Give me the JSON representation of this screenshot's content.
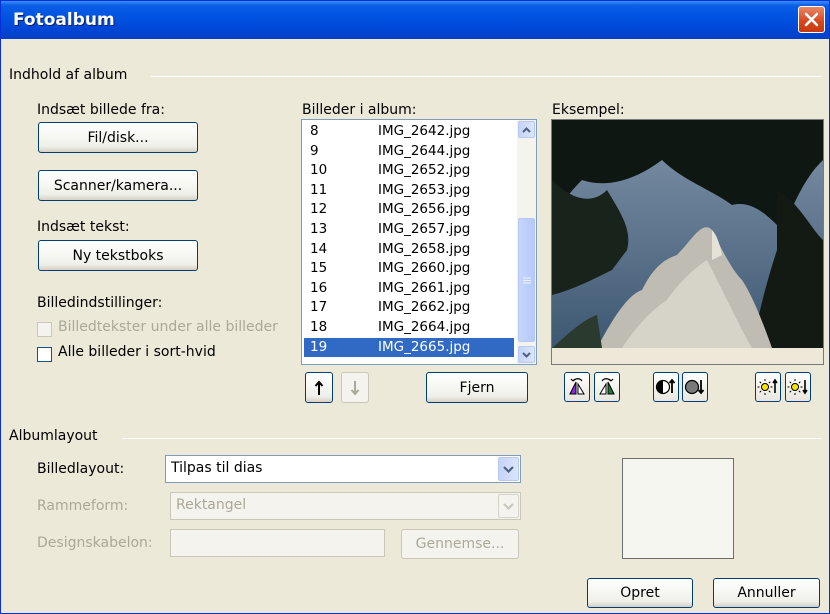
{
  "window": {
    "title": "Fotoalbum"
  },
  "content_group": {
    "title": "Indhold af album",
    "insert_picture_from": "Indsæt billede fra:",
    "file_disk_button": "Fil/disk...",
    "scanner_camera_button": "Scanner/kamera...",
    "insert_text": "Indsæt tekst:",
    "new_textbox_button": "Ny tekstboks",
    "picture_options": "Billedindstillinger:",
    "captions_checkbox": {
      "label": "Billedtekster under alle billeder",
      "checked": false,
      "enabled": false
    },
    "bw_checkbox": {
      "label": "Alle billeder i sort-hvid",
      "checked": false,
      "enabled": true
    }
  },
  "pictures_list": {
    "label": "Billeder i album:",
    "items": [
      {
        "num": "8",
        "file": "IMG_2642.jpg"
      },
      {
        "num": "9",
        "file": "IMG_2644.jpg"
      },
      {
        "num": "10",
        "file": "IMG_2652.jpg"
      },
      {
        "num": "11",
        "file": "IMG_2653.jpg"
      },
      {
        "num": "12",
        "file": "IMG_2656.jpg"
      },
      {
        "num": "13",
        "file": "IMG_2657.jpg"
      },
      {
        "num": "14",
        "file": "IMG_2658.jpg"
      },
      {
        "num": "15",
        "file": "IMG_2660.jpg"
      },
      {
        "num": "16",
        "file": "IMG_2661.jpg"
      },
      {
        "num": "17",
        "file": "IMG_2662.jpg"
      },
      {
        "num": "18",
        "file": "IMG_2664.jpg"
      },
      {
        "num": "19",
        "file": "IMG_2665.jpg"
      }
    ],
    "selected_index": 11,
    "move_up_icon": "arrow-up-icon",
    "move_down_icon": "arrow-down-icon",
    "remove_button": "Fjern"
  },
  "preview": {
    "label": "Eksempel:",
    "tool_icons": [
      "rotate-left-icon",
      "rotate-right-icon",
      "contrast-up-icon",
      "contrast-down-icon",
      "brightness-up-icon",
      "brightness-down-icon"
    ]
  },
  "album_layout": {
    "title": "Albumlayout",
    "picture_layout_label": "Billedlayout:",
    "picture_layout_value": "Tilpas til dias",
    "frame_shape_label": "Rammeform:",
    "frame_shape_value": "Rektangel",
    "design_template_label": "Designskabelon:",
    "design_template_value": "",
    "browse_button": "Gennemse..."
  },
  "footer": {
    "create_button": "Opret",
    "cancel_button": "Annuller"
  },
  "colors": {
    "title_bar": "#0052e0",
    "selection": "#316ac5",
    "dialog_bg": "#ece9d8"
  }
}
